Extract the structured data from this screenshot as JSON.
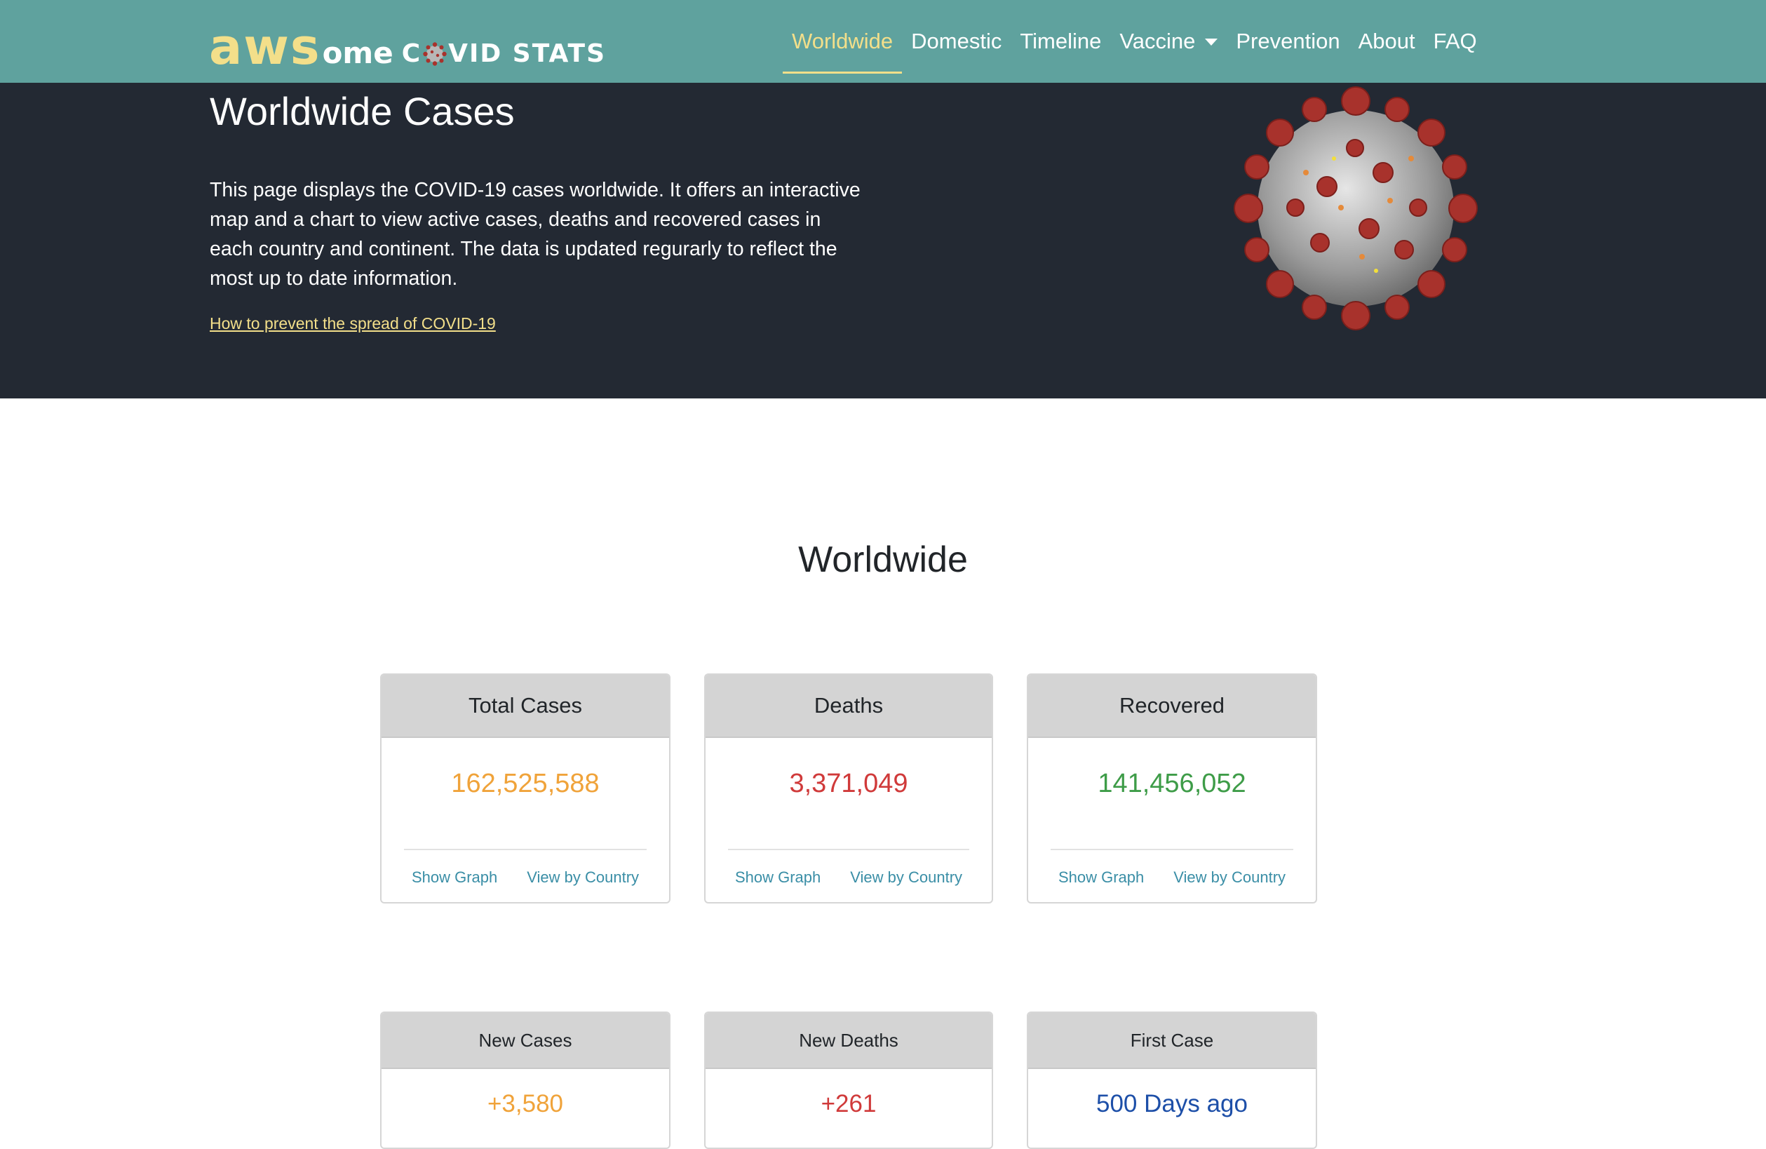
{
  "brand": {
    "part1": "aws",
    "part2": "ome",
    "part3_pre": "C",
    "part3_post": "VID STATS"
  },
  "nav": {
    "items": [
      {
        "label": "Worldwide"
      },
      {
        "label": "Domestic"
      },
      {
        "label": "Timeline"
      },
      {
        "label": "Vaccine"
      },
      {
        "label": "Prevention"
      },
      {
        "label": "About"
      },
      {
        "label": "FAQ"
      }
    ],
    "active": "Worldwide"
  },
  "hero": {
    "title": "Worldwide Cases",
    "description": "This page displays the COVID-19 cases worldwide. It offers an interactive map and a chart to view active cases, deaths and recovered cases in each country and continent. The data is updated regurarly to reflect the most up to date information.",
    "link": "How to prevent the spread of COVID-19"
  },
  "section": {
    "title": "Worldwide"
  },
  "cards": [
    {
      "title": "Total Cases",
      "value": "162,525,588",
      "color": "#f0a33a",
      "link1": "Show Graph",
      "link2": "View by Country"
    },
    {
      "title": "Deaths",
      "value": "3,371,049",
      "color": "#d03a3a",
      "link1": "Show Graph",
      "link2": "View by Country"
    },
    {
      "title": "Recovered",
      "value": "141,456,052",
      "color": "#3e9c48",
      "link1": "Show Graph",
      "link2": "View by Country"
    }
  ],
  "small_cards": [
    {
      "title": "New Cases",
      "value": "+3,580",
      "color": "#f0a33a"
    },
    {
      "title": "New Deaths",
      "value": "+261",
      "color": "#d03a3a"
    },
    {
      "title": "First Case",
      "value": "500 Days ago",
      "color": "#1d4fa8"
    }
  ],
  "colors": {
    "navbar": "#5fa29e",
    "hero": "#232933",
    "accent": "#f3df8a"
  }
}
